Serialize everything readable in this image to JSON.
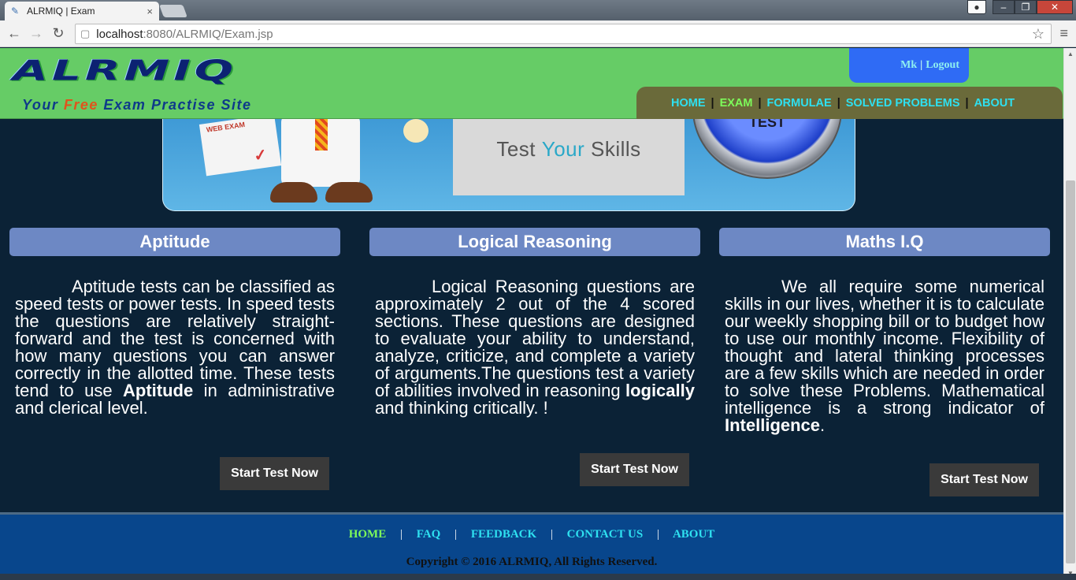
{
  "browser": {
    "tab_title": "ALRMIQ | Exam",
    "tab_close": "×",
    "url_host": "localhost",
    "url_path": ":8080/ALRMIQ/Exam.jsp"
  },
  "header": {
    "logo_text": "ALRMIQ",
    "tagline_your": "Your",
    "tagline_free": "Free",
    "tagline_rest": "Exam Practise Site",
    "user_name": "Mk",
    "user_sep": "|",
    "logout_label": "Logout"
  },
  "nav": {
    "home": "HOME",
    "exam": "EXAM",
    "formulae": "FORMULAE",
    "solved": "SOLVED PROBLEMS",
    "about": "ABOUT",
    "sep": "|"
  },
  "banner": {
    "paper_label": "WEB EXAM",
    "skills_test": "Test",
    "skills_your": "Your",
    "skills_skills": "Skills",
    "test_button": "TEST"
  },
  "sections": {
    "aptitude": {
      "title": "Aptitude",
      "text_before": "Aptitude tests can be classified as speed tests or power tests. In speed tests the questions are relatively straight-forward and the test is concerned with how many questions you can answer correctly in the allotted time. These tests tend to use ",
      "bold": "Aptitude",
      "text_after": " in administrative and clerical level.",
      "button": "Start Test Now"
    },
    "logical": {
      "title": "Logical Reasoning",
      "text_before": "Logical Reasoning questions are approximately 2 out of the 4 scored sections. These questions are designed to evaluate your ability to understand, analyze, criticize, and complete a variety of arguments.The questions test a variety of abilities involved in reasoning ",
      "bold": "logically",
      "text_after": " and thinking critically. !",
      "button": "Start Test Now"
    },
    "maths": {
      "title": "Maths I.Q",
      "text_before": "We all require some numerical skills in our lives, whether it is to calculate our weekly shopping bill or to budget how to use our monthly income. Flexibility of thought and lateral thinking processes are a few skills which are needed in order to solve these  Problems. Mathematical intelligence is a strong indicator of ",
      "bold": "Intelligence",
      "text_after": ".",
      "button": "Start Test Now"
    }
  },
  "footer": {
    "home": "HOME",
    "faq": "FAQ",
    "feedback": "FEEDBACK",
    "contact": "CONTACT US",
    "about": "ABOUT",
    "sep": "|",
    "copyright": "Copyright © 2016 ALRMIQ, All Rights Reserved."
  },
  "colors": {
    "header_green": "#66cc66",
    "nav_link": "#2ee0f0",
    "nav_active": "#7dfa5a",
    "page_bg": "#0b2236",
    "section_header": "#6d88c4",
    "footer_bg": "#08468c"
  }
}
